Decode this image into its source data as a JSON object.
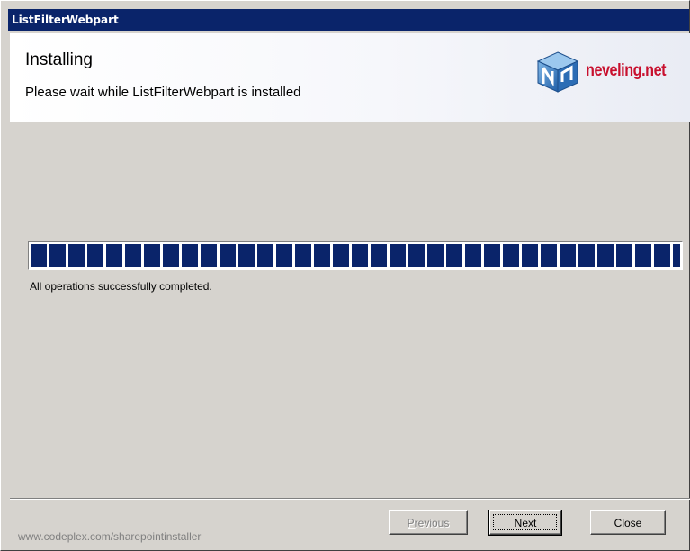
{
  "window": {
    "title": "ListFilterWebpart"
  },
  "header": {
    "title": "Installing",
    "subtitle": "Please wait while ListFilterWebpart is installed",
    "logo_text": "neveling.net",
    "logo_icon": "nn-cube-logo-icon"
  },
  "progress": {
    "percent": 100,
    "status_text": "All operations successfully completed."
  },
  "footer": {
    "link_text": "www.codeplex.com/sharepointinstaller",
    "buttons": {
      "previous": {
        "underline": "P",
        "rest": "revious",
        "enabled": false
      },
      "next": {
        "underline": "N",
        "rest": "ext",
        "enabled": true
      },
      "close": {
        "underline": "C",
        "rest": "lose",
        "enabled": true
      }
    }
  },
  "colors": {
    "titlebar": "#0a246a",
    "progress_fill": "#0a246a",
    "logo_red": "#c8102e",
    "dialog_face": "#d6d3ce"
  }
}
